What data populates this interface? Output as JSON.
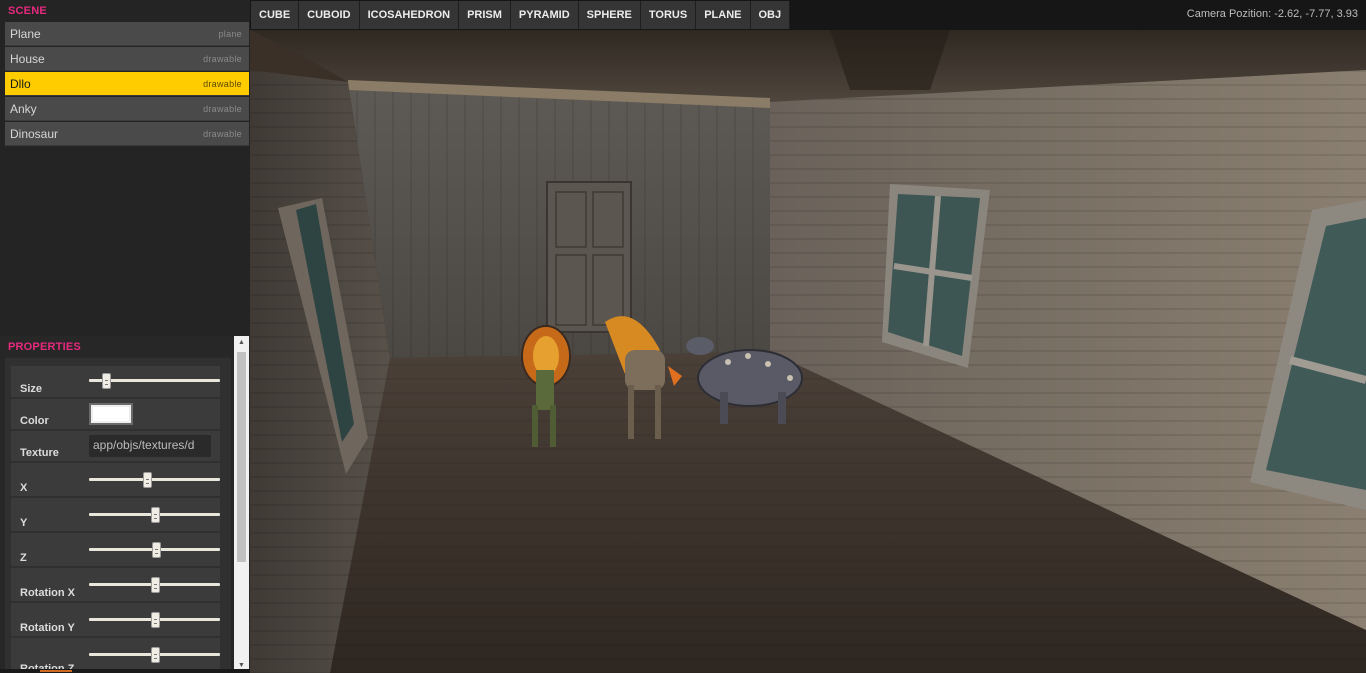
{
  "scene": {
    "title": "SCENE",
    "items": [
      {
        "name": "Plane",
        "kind": "plane",
        "selected": false
      },
      {
        "name": "House",
        "kind": "drawable",
        "selected": false
      },
      {
        "name": "Dllo",
        "kind": "drawable",
        "selected": true
      },
      {
        "name": "Anky",
        "kind": "drawable",
        "selected": false
      },
      {
        "name": "Dinosaur",
        "kind": "drawable",
        "selected": false
      }
    ]
  },
  "properties": {
    "title": "PROPERTIES",
    "size_label": "Size",
    "size_value": 0.13,
    "color_label": "Color",
    "color_value": "#ffffff",
    "texture_label": "Texture",
    "texture_value": "app/objs/textures/d",
    "x_label": "X",
    "x_value": 0.44,
    "y_label": "Y",
    "y_value": 0.5,
    "z_label": "Z",
    "z_value": 0.51,
    "rotx_label": "Rotation X",
    "rotx_value": 0.5,
    "roty_label": "Rotation Y",
    "roty_value": 0.5,
    "rotz_label": "Rotation Z",
    "rotz_value": 0.5
  },
  "toolbar": {
    "buttons": [
      "CUBE",
      "CUBOID",
      "ICOSAHEDRON",
      "PRISM",
      "PYRAMID",
      "SPHERE",
      "TORUS",
      "PLANE",
      "OBJ"
    ],
    "camera_label": "Camera Pozition:",
    "camera_value": "-2.62, -7.77, 3.93"
  },
  "colors": {
    "accent": "#e8297e",
    "selected": "#ffcc00"
  }
}
